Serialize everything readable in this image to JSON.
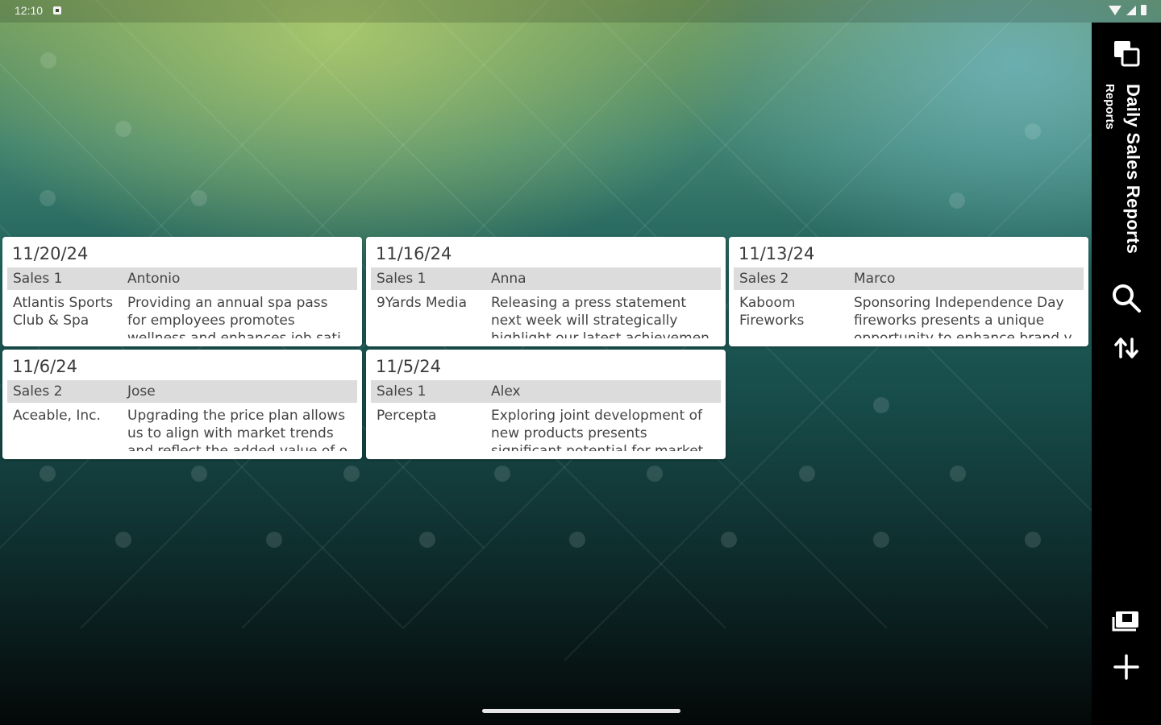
{
  "status_bar": {
    "time": "12:10"
  },
  "app": {
    "title": "Daily Sales Reports",
    "subtitle": "Reports"
  },
  "reports": [
    {
      "date": "11/20/24",
      "team": "Sales 1",
      "person": "Antonio",
      "company": "Atlantis Sports Club & Spa",
      "note": "Providing an annual spa pass for employees promotes wellness and enhances job sati"
    },
    {
      "date": "11/16/24",
      "team": "Sales 1",
      "person": "Anna",
      "company": "9Yards Media",
      "note": "Releasing a press statement next week will strategically highlight our latest achievemen"
    },
    {
      "date": "11/13/24",
      "team": "Sales 2",
      "person": "Marco",
      "company": "Kaboom Fireworks",
      "note": "Sponsoring Independence Day fireworks presents a unique opportunity to enhance brand v"
    },
    {
      "date": "11/6/24",
      "team": "Sales 2",
      "person": "Jose",
      "company": "Aceable, Inc.",
      "note": "Upgrading the price plan allows us to align with market trends and reflect the added value of o"
    },
    {
      "date": "11/5/24",
      "team": "Sales 1",
      "person": "Alex",
      "company": "Percepta",
      "note": "Exploring joint development of new products presents significant potential for market"
    }
  ],
  "rail_icons": [
    "switch-view-icon",
    "search-icon",
    "sort-icon",
    "slideshow-icon",
    "add-icon"
  ]
}
